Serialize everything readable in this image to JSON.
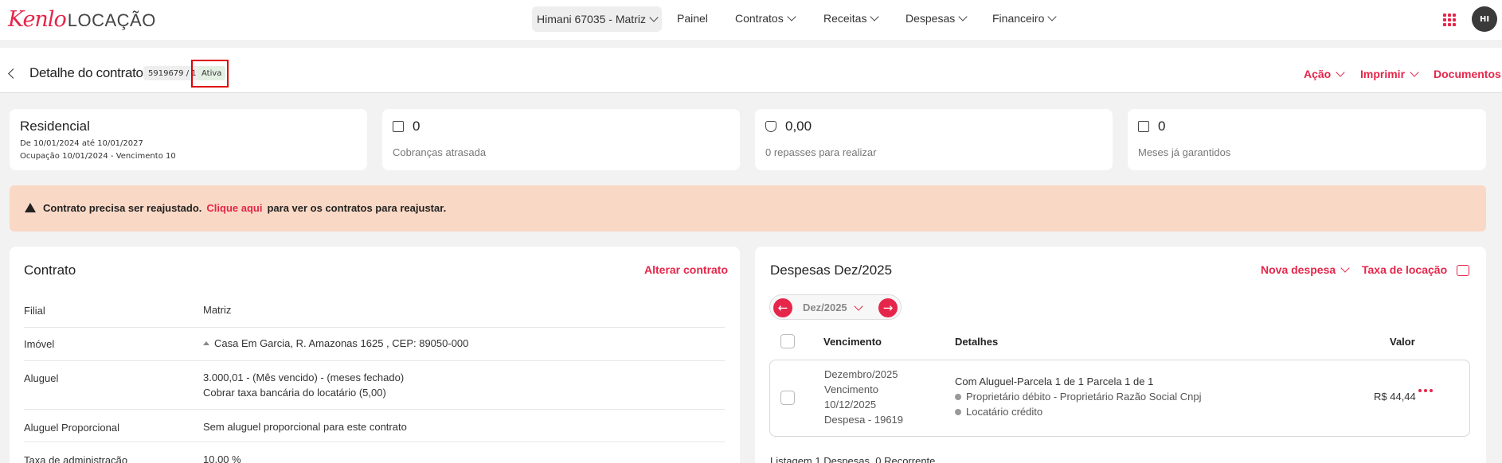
{
  "brand": {
    "logo_main": "Kenlo",
    "logo_sub": "LOCAÇÃO"
  },
  "nav": {
    "branch": "Himani 67035 - Matriz",
    "items": [
      "Painel",
      "Contratos",
      "Receitas",
      "Despesas",
      "Financeiro"
    ]
  },
  "user": {
    "initials": "HI"
  },
  "header": {
    "title": "Detalhe do contrato",
    "contract_code": "5919679 / 1",
    "status": "Ativa",
    "actions": {
      "acao": "Ação",
      "imprimir": "Imprimir",
      "documentos": "Documentos"
    }
  },
  "summary": {
    "type": "Residencial",
    "period": "De 10/01/2024 até 10/01/2027",
    "occupation": "Ocupação 10/01/2024 - Vencimento 10",
    "late_charges_count": "0",
    "late_charges_label": "Cobranças atrasada",
    "transfers_value": "0,00",
    "transfers_label": "0 repasses para realizar",
    "guaranteed_count": "0",
    "guaranteed_label": "Meses já garantidos"
  },
  "alert": {
    "text": "Contrato precisa ser reajustado.",
    "link": "Clique aqui",
    "suffix": "para ver os contratos para reajustar."
  },
  "contract": {
    "title": "Contrato",
    "edit_link": "Alterar contrato",
    "rows": [
      {
        "label": "Filial",
        "value": "Matriz"
      },
      {
        "label": "Imóvel",
        "value": "Casa Em Garcia, R. Amazonas 1625 , CEP: 89050-000"
      },
      {
        "label": "Aluguel",
        "value": "3.000,01 - (Mês vencido) - (meses fechado)",
        "value2": "Cobrar taxa bancária do locatário (5,00)"
      },
      {
        "label": "Aluguel Proporcional",
        "value": "Sem aluguel proporcional para este contrato"
      },
      {
        "label": "Taxa de administração",
        "value": "10,00 %"
      }
    ]
  },
  "expenses": {
    "title": "Despesas Dez/2025",
    "new_link": "Nova despesa",
    "fee_link": "Taxa de locação",
    "month": "Dez/2025",
    "columns": {
      "due": "Vencimento",
      "details": "Detalhes",
      "value": "Valor"
    },
    "row": {
      "month": "Dezembro/2025",
      "due_label": "Vencimento",
      "due_date": "10/12/2025",
      "expense_id": "Despesa - 19619",
      "detail": "Com Aluguel-Parcela 1 de 1 Parcela 1 de 1",
      "debit": "Proprietário débito - Proprietário Razão Social Cnpj",
      "credit": "Locatário crédito",
      "value": "R$ 44,44"
    },
    "footer": "Listagem 1 Despesas, 0 Recorrente"
  },
  "colors": {
    "accent": "#e5264a",
    "alert_bg": "#f9d8c5",
    "highlight": "#e00000"
  }
}
